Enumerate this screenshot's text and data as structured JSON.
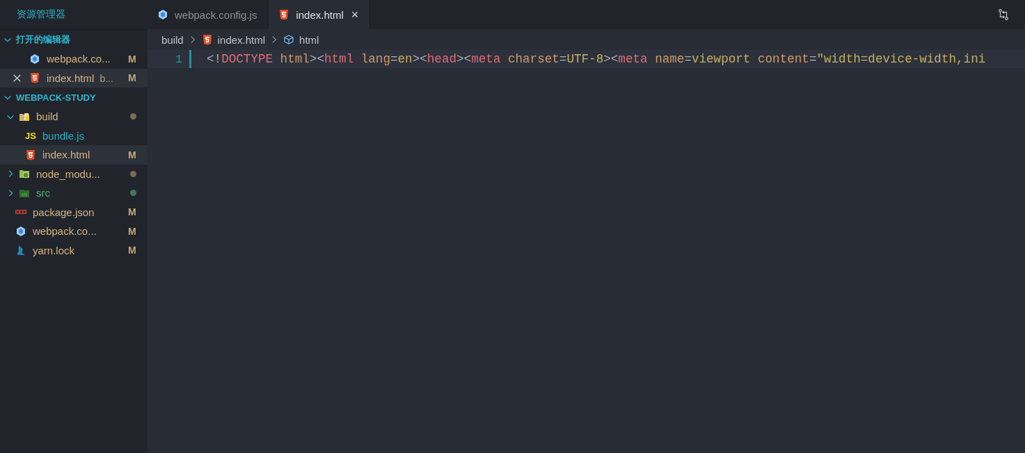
{
  "sidebar": {
    "title": "资源管理器",
    "sections": [
      {
        "title": "打开的编辑器",
        "expanded": true,
        "items": [
          {
            "label": "webpack.co...",
            "kind": "webpack",
            "status": "M",
            "selected": false,
            "close": false
          },
          {
            "label": "index.html",
            "description": "b...",
            "kind": "html",
            "status": "M",
            "selected": true,
            "close": true
          }
        ]
      },
      {
        "title": "WEBPACK-STUDY",
        "expanded": true,
        "tree": [
          {
            "label": "build",
            "kind": "folderbuild",
            "expanded": true,
            "color": "#7a6a55",
            "selected": false,
            "children": [
              {
                "label": "bundle.js",
                "kind": "js",
                "badge": "JS",
                "selected": false
              },
              {
                "label": "index.html",
                "kind": "html",
                "status": "M",
                "selected": true
              }
            ]
          },
          {
            "label": "node_modu...",
            "kind": "foldernode",
            "expanded": false,
            "color": "#7a6a55",
            "selected": false
          },
          {
            "label": "src",
            "kind": "foldersrc",
            "expanded": false,
            "color": "#3f7a55",
            "selected": false
          },
          {
            "label": "package.json",
            "kind": "npm",
            "status": "M",
            "selected": false
          },
          {
            "label": "webpack.co...",
            "kind": "webpack",
            "status": "M",
            "selected": false
          },
          {
            "label": "yarn.lock",
            "kind": "yarn",
            "status": "M",
            "selected": false
          }
        ]
      }
    ]
  },
  "tabs": [
    {
      "label": "webpack.config.js",
      "kind": "webpack",
      "selected": false
    },
    {
      "label": "index.html",
      "kind": "html",
      "selected": true,
      "close": "×"
    }
  ],
  "breadcrumbs": [
    {
      "label": "build",
      "kind": "folder"
    },
    {
      "label": "index.html",
      "kind": "html"
    },
    {
      "label": "html",
      "kind": "element"
    }
  ],
  "editor": {
    "lines": [
      {
        "number": "1",
        "tokens": [
          {
            "text": "<!",
            "kind": "punct"
          },
          {
            "text": "DOCTYPE",
            "kind": "tag"
          },
          {
            "text": " html",
            "kind": "attr"
          },
          {
            "text": "><",
            "kind": "punct"
          },
          {
            "text": "html",
            "kind": "tag"
          },
          {
            "text": " lang",
            "kind": "attr"
          },
          {
            "text": "=",
            "kind": "punct"
          },
          {
            "text": "en",
            "kind": "value"
          },
          {
            "text": "><",
            "kind": "punct"
          },
          {
            "text": "head",
            "kind": "tag"
          },
          {
            "text": "><",
            "kind": "punct"
          },
          {
            "text": "meta",
            "kind": "tag"
          },
          {
            "text": " charset",
            "kind": "attr"
          },
          {
            "text": "=",
            "kind": "punct"
          },
          {
            "text": "UTF-8",
            "kind": "value"
          },
          {
            "text": "><",
            "kind": "punct"
          },
          {
            "text": "meta",
            "kind": "tag"
          },
          {
            "text": " name",
            "kind": "attr"
          },
          {
            "text": "=",
            "kind": "punct"
          },
          {
            "text": "viewport",
            "kind": "value"
          },
          {
            "text": " content",
            "kind": "attr"
          },
          {
            "text": "=",
            "kind": "punct"
          },
          {
            "text": "\"width=device-width,ini",
            "kind": "value"
          }
        ]
      }
    ]
  }
}
